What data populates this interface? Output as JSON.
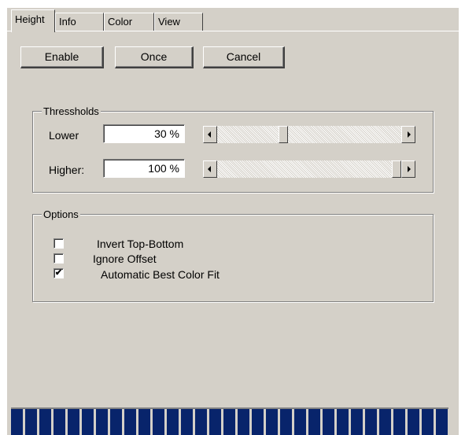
{
  "tabs": [
    {
      "label": "Height",
      "active": true
    },
    {
      "label": "Info",
      "active": false
    },
    {
      "label": "Color",
      "active": false
    },
    {
      "label": "View",
      "active": false
    }
  ],
  "buttons": {
    "enable": "Enable",
    "once": "Once",
    "cancel": "Cancel"
  },
  "thresholds": {
    "title": "Thressholds",
    "lower": {
      "label": "Lower",
      "value": "30 %",
      "slider_fraction": 0.35
    },
    "higher": {
      "label": "Higher:",
      "value": "100 %",
      "slider_fraction": 1.0
    }
  },
  "options": {
    "title": "Options",
    "items": [
      {
        "label": "Invert Top-Bottom",
        "checked": false
      },
      {
        "label": "Ignore Offset",
        "checked": false
      },
      {
        "label": "Automatic Best Color Fit",
        "checked": true
      }
    ]
  },
  "progress": {
    "fraction": 1.0
  },
  "colors": {
    "face": "#d4d0c8",
    "progress": "#08246b"
  }
}
